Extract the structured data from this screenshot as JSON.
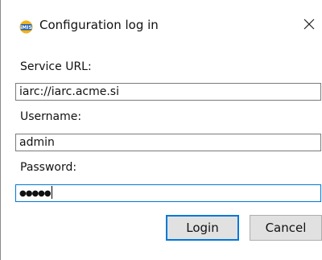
{
  "window": {
    "title": "Configuration log in",
    "icon": "imis-app-icon",
    "close_glyph": "✕"
  },
  "form": {
    "service_url_label": "Service URL:",
    "service_url_value": "iarc://iarc.acme.si",
    "username_label": "Username:",
    "username_value": "admin",
    "password_label": "Password:",
    "password_mask": "●●●●●"
  },
  "buttons": {
    "login": "Login",
    "cancel": "Cancel"
  },
  "colors": {
    "focus_accent": "#0078d7",
    "button_face": "#e1e1e1"
  }
}
